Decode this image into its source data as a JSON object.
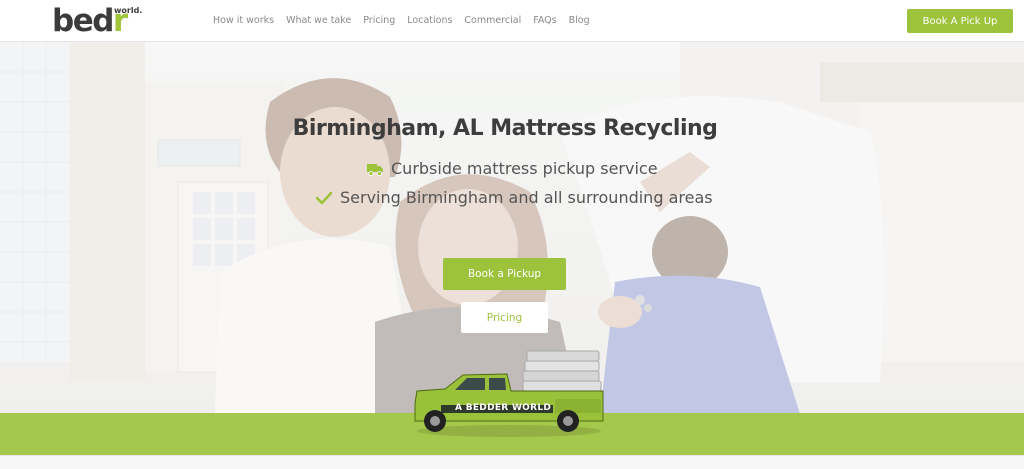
{
  "brand": {
    "logo_text": "bedr",
    "logo_sup": "world."
  },
  "nav": {
    "items": [
      "How it works",
      "What we take",
      "Pricing",
      "Locations",
      "Commercial",
      "FAQs",
      "Blog"
    ]
  },
  "header": {
    "cta_label": "Book A Pick Up"
  },
  "hero": {
    "title": "Birmingham, AL Mattress Recycling",
    "features": [
      {
        "icon": "truck-icon",
        "text": "Curbside mattress pickup service"
      },
      {
        "icon": "check-icon",
        "text": "Serving Birmingham and all surrounding areas"
      }
    ],
    "primary_button": "Book a Pickup",
    "secondary_button": "Pricing",
    "truck_text": "A BEDDER WORLD"
  },
  "colors": {
    "accent": "#9cc33b",
    "band": "#a4c84c",
    "heading": "#3d3d3d",
    "body": "#555555"
  }
}
